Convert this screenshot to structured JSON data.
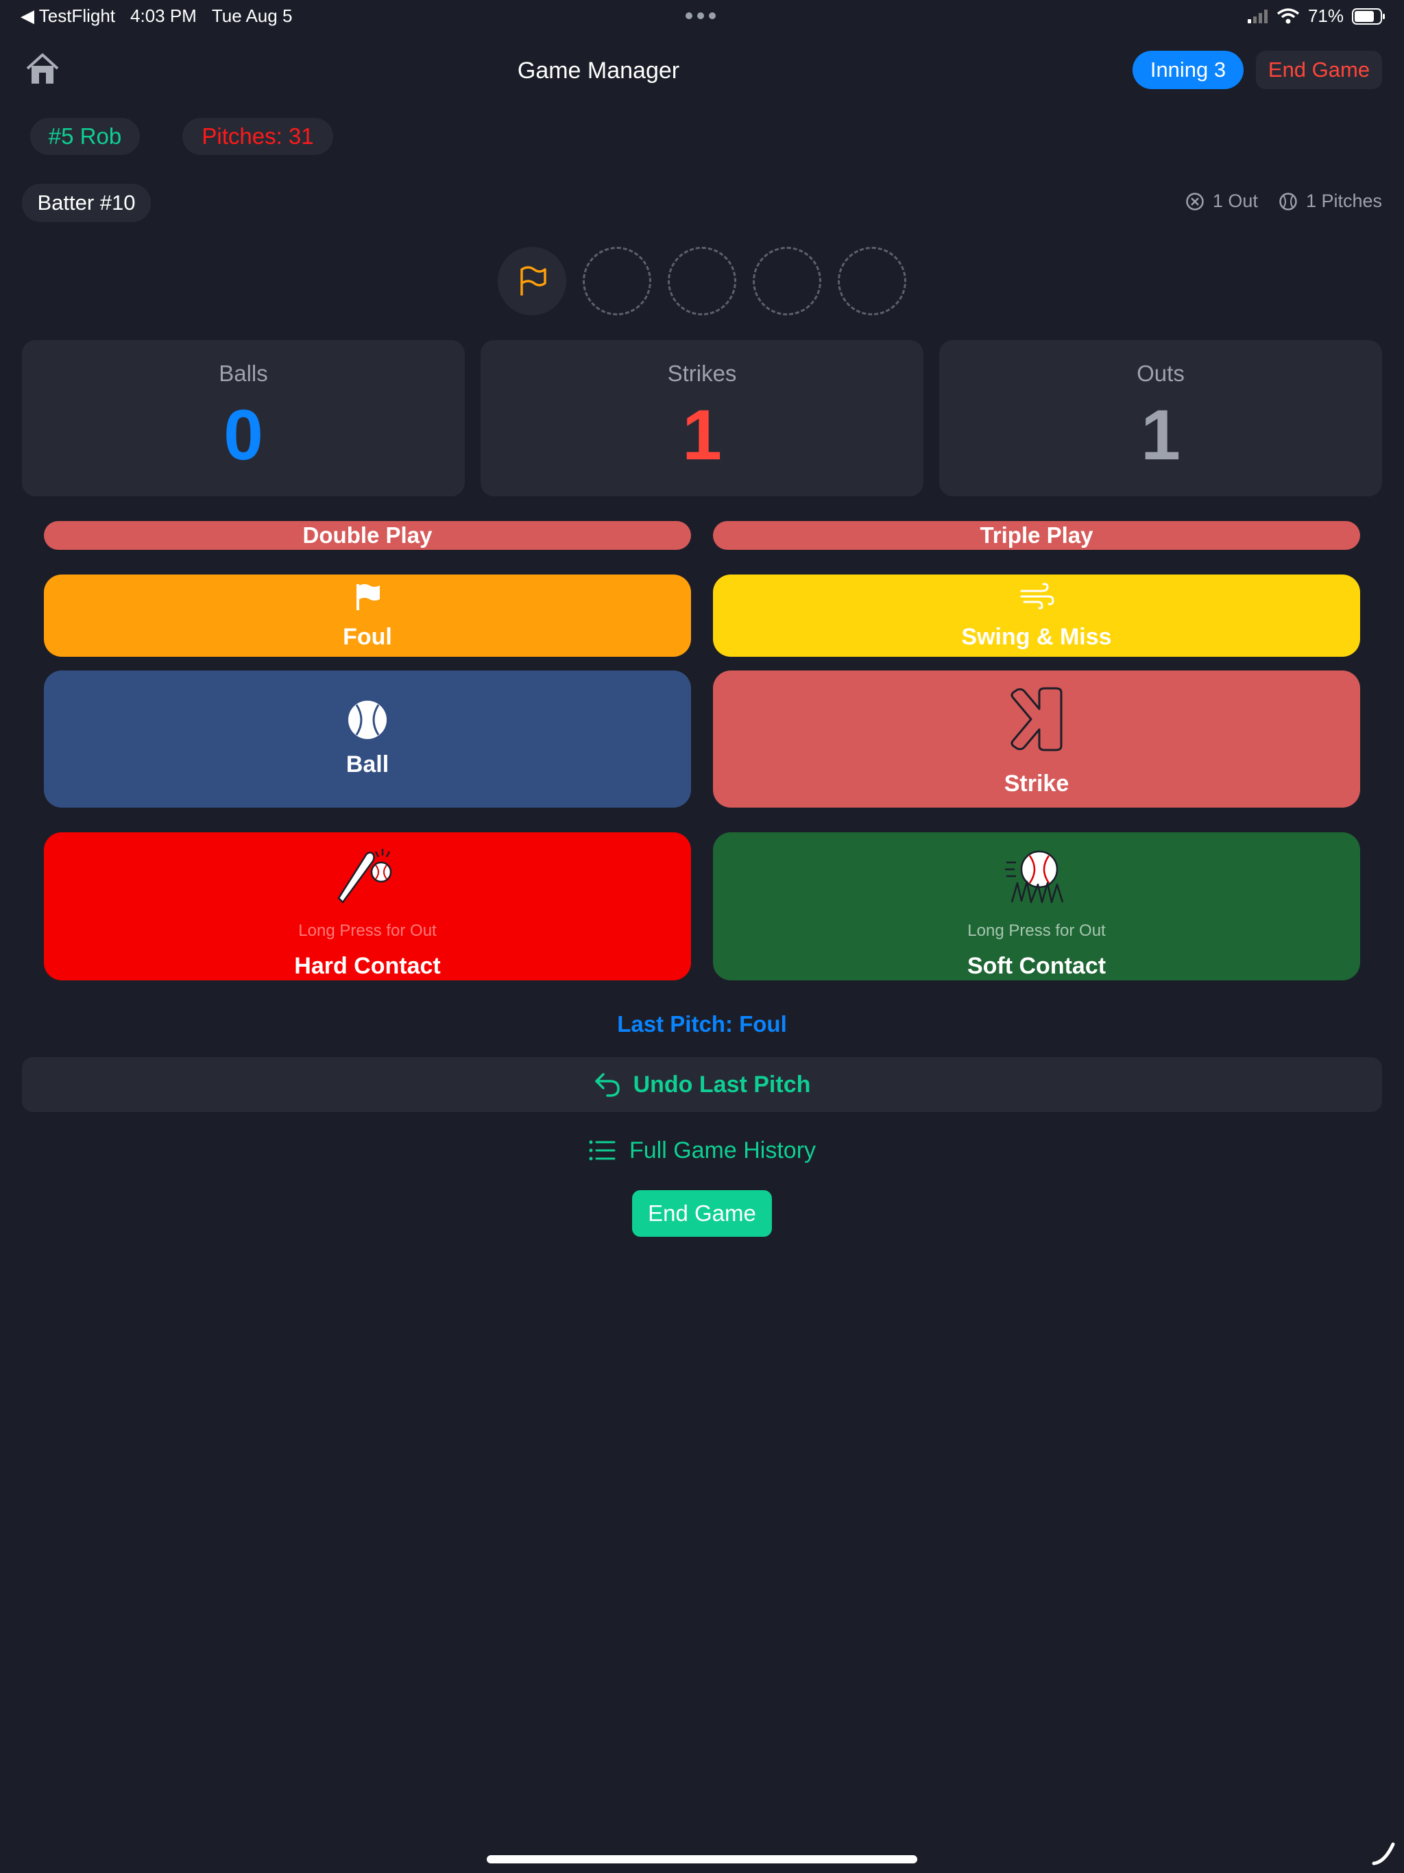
{
  "status_bar": {
    "back_app": "◀ TestFlight",
    "time": "4:03 PM",
    "date": "Tue Aug 5",
    "battery": "71%"
  },
  "header": {
    "title": "Game Manager",
    "inning": "Inning 3",
    "end_game": "End Game"
  },
  "pitcher": {
    "name": "#5 Rob",
    "pitches": "Pitches: 31"
  },
  "batter": {
    "label": "Batter #10",
    "outs": "1 Out",
    "pitches": "1 Pitches"
  },
  "counts": {
    "balls_label": "Balls",
    "balls": "0",
    "strikes_label": "Strikes",
    "strikes": "1",
    "outs_label": "Outs",
    "outs": "1"
  },
  "actions": {
    "double_play": "Double Play",
    "triple_play": "Triple Play",
    "foul": "Foul",
    "swing_miss": "Swing & Miss",
    "ball": "Ball",
    "strike": "Strike",
    "hard_contact": "Hard Contact",
    "hard_hint": "Long Press for Out",
    "soft_contact": "Soft Contact",
    "soft_hint": "Long Press for Out"
  },
  "footer": {
    "last_pitch": "Last Pitch: Foul",
    "undo": "Undo Last Pitch",
    "history": "Full Game History",
    "end_game": "End Game"
  },
  "colors": {
    "background": "#1b1e28",
    "card": "#272a35",
    "accent_blue": "#0a84ff",
    "accent_green": "#0fcf93",
    "accent_red": "#ff453a",
    "foul": "#ff9f0a",
    "swing": "#ffd60a",
    "ball": "#334f82",
    "strike": "#d65a5a",
    "hard": "#f50000",
    "soft": "#1e6634"
  }
}
